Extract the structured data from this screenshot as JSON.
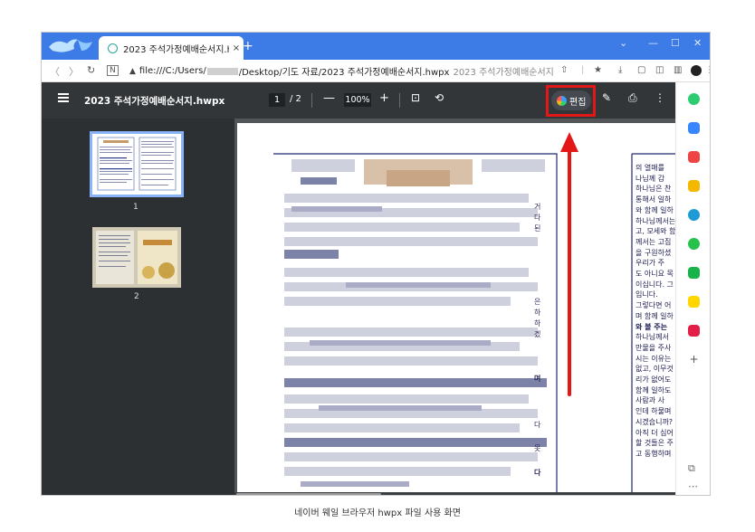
{
  "browser": {
    "tab_title": "2023 주석가정예배순서지.hwpx",
    "tab_close": "×",
    "new_tab": "+",
    "window_controls": {
      "chevron": "⌄",
      "minimize": "—",
      "maximize": "☐",
      "close": "✕"
    },
    "url_prefix": "file:///C:/Users/",
    "url_suffix": "/Desktop/기도 자료/2023 주석가정예배순서지.hwpx",
    "url_title_hint": "2023 주석가정예배순서지"
  },
  "pdf_toolbar": {
    "doc_title": "2023 주석가정예배순서지.hwpx",
    "current_page": "1",
    "total_pages": "/ 2",
    "zoom": "100%",
    "edit_label": "편집"
  },
  "thumbnails": [
    {
      "number": "1"
    },
    {
      "number": "2"
    }
  ],
  "document_right_text": [
    "의 열매를",
    "나님께 감",
    "하나님은 찬",
    "통해서 일하",
    "와 함께 일하",
    "하나님께서는",
    "고, 모세와 함",
    "께서는 고집",
    "을 구원하셨",
    "우리가 주",
    "도 아니요 목",
    "이십니다. 그",
    "입니다.",
    "그렇다면 어",
    "며 함께 일하",
    "와 볼 주는",
    "하나님께서",
    "만물을 주사",
    "시는 이유는",
    "없고, 이무것",
    "리가 없어도",
    "함께 일하도",
    "사람과 사",
    "인데 하물며",
    "시겠습니까?",
    "아직 더 심어",
    "할 것들은 주",
    "고 동행하며"
  ],
  "document_mid_fragments": [
    "거",
    "다",
    "된",
    "은",
    "하",
    "하",
    "겠",
    "며",
    "다",
    "못",
    "다"
  ],
  "caption": "네이버 웨일 브라우저 hwpx 파일 사용 화면",
  "colors": {
    "titlebar": "#3d7be6",
    "toolbar": "#323639",
    "sidebar": "#2d3033",
    "highlight": "#e41717",
    "border_blue": "#1f2a6e"
  },
  "icons": [
    "whale-logo-icon",
    "back-icon",
    "forward-icon",
    "reload-icon",
    "reader-icon",
    "lock-icon",
    "share-icon",
    "bookmark-icon",
    "download-icon",
    "menu-icon",
    "fit-page-icon",
    "rotate-icon",
    "pen-icon",
    "print-icon",
    "more-icon"
  ]
}
